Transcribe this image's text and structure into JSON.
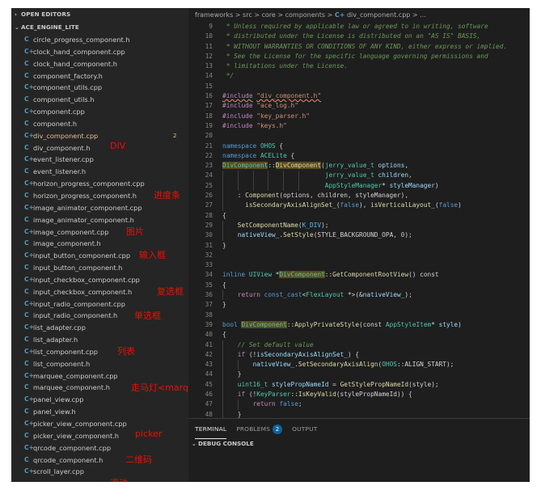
{
  "sidebar": {
    "open_editors_label": "OPEN EDITORS",
    "project_label": "ACE_ENGINE_LITE",
    "files": [
      {
        "icon": "C",
        "name": "circle_progress_component.h"
      },
      {
        "icon": "C+",
        "name": "clock_hand_component.cpp"
      },
      {
        "icon": "C",
        "name": "clock_hand_component.h"
      },
      {
        "icon": "C",
        "name": "component_factory.h"
      },
      {
        "icon": "C+",
        "name": "component_utils.cpp"
      },
      {
        "icon": "C",
        "name": "component_utils.h"
      },
      {
        "icon": "C+",
        "name": "component.cpp"
      },
      {
        "icon": "C",
        "name": "component.h"
      },
      {
        "icon": "C+",
        "name": "div_component.cpp",
        "selected": true,
        "badge": "2"
      },
      {
        "icon": "C",
        "name": "div_component.h"
      },
      {
        "icon": "C+",
        "name": "event_listener.cpp"
      },
      {
        "icon": "C",
        "name": "event_listener.h"
      },
      {
        "icon": "C+",
        "name": "horizon_progress_component.cpp"
      },
      {
        "icon": "C",
        "name": "horizon_progress_component.h"
      },
      {
        "icon": "C+",
        "name": "image_animator_component.cpp"
      },
      {
        "icon": "C",
        "name": "image_animator_component.h"
      },
      {
        "icon": "C+",
        "name": "image_component.cpp"
      },
      {
        "icon": "C",
        "name": "image_component.h"
      },
      {
        "icon": "C+",
        "name": "input_button_component.cpp"
      },
      {
        "icon": "C",
        "name": "input_button_component.h"
      },
      {
        "icon": "C+",
        "name": "input_checkbox_component.cpp"
      },
      {
        "icon": "C",
        "name": "input_checkbox_component.h"
      },
      {
        "icon": "C+",
        "name": "input_radio_component.cpp"
      },
      {
        "icon": "C",
        "name": "input_radio_component.h"
      },
      {
        "icon": "C+",
        "name": "list_adapter.cpp"
      },
      {
        "icon": "C",
        "name": "list_adapter.h"
      },
      {
        "icon": "C+",
        "name": "list_component.cpp"
      },
      {
        "icon": "C",
        "name": "list_component.h"
      },
      {
        "icon": "C+",
        "name": "marquee_component.cpp"
      },
      {
        "icon": "C",
        "name": "marquee_component.h"
      },
      {
        "icon": "C+",
        "name": "panel_view.cpp"
      },
      {
        "icon": "C",
        "name": "panel_view.h"
      },
      {
        "icon": "C+",
        "name": "picker_view_component.cpp"
      },
      {
        "icon": "C",
        "name": "picker_view_component.h"
      },
      {
        "icon": "C+",
        "name": "qrcode_component.cpp"
      },
      {
        "icon": "C",
        "name": "qrcode_component.h"
      },
      {
        "icon": "C+",
        "name": "scroll_layer.cpp"
      }
    ]
  },
  "annotations": [
    {
      "text": "DIV",
      "row": 9
    },
    {
      "text": "进度条",
      "row": 13
    },
    {
      "text": "图片",
      "row": 16
    },
    {
      "text": "输入框",
      "row": 18
    },
    {
      "text": "复选框",
      "row": 21
    },
    {
      "text": "单选框",
      "row": 23
    },
    {
      "text": "列表",
      "row": 26
    },
    {
      "text": "走马灯<marquee>",
      "row": 29
    },
    {
      "text": "picker",
      "row": 33
    },
    {
      "text": "二维码",
      "row": 35
    },
    {
      "text": "滚动",
      "row": 37
    }
  ],
  "breadcrumb": {
    "path": "frameworks > src > core > components > ",
    "file_icon": "C+",
    "file": "div_component.cpp",
    "tail": " > ..."
  },
  "code": [
    {
      "n": "9",
      "t": [
        [
          "cm",
          " * Unless required by applicable law or agreed to in writing, software"
        ]
      ]
    },
    {
      "n": "10",
      "t": [
        [
          "cm",
          " * distributed under the License is distributed on an \"AS IS\" BASIS,"
        ]
      ]
    },
    {
      "n": "11",
      "t": [
        [
          "cm",
          " * WITHOUT WARRANTIES OR CONDITIONS OF ANY KIND, either express or implied."
        ]
      ]
    },
    {
      "n": "12",
      "t": [
        [
          "cm",
          " * See the License for the specific language governing permissions and"
        ]
      ]
    },
    {
      "n": "13",
      "t": [
        [
          "cm",
          " * limitations under the License."
        ]
      ]
    },
    {
      "n": "14",
      "t": [
        [
          "cm",
          " */"
        ]
      ]
    },
    {
      "n": "15",
      "t": []
    },
    {
      "n": "16",
      "t": [
        [
          "kw2 sq",
          "#include"
        ],
        [
          "pl",
          " "
        ],
        [
          "str sq",
          "\"div_component.h\""
        ]
      ]
    },
    {
      "n": "17",
      "t": [
        [
          "kw2",
          "#include"
        ],
        [
          "pl",
          " "
        ],
        [
          "str",
          "\"ace_log.h\""
        ]
      ]
    },
    {
      "n": "18",
      "t": [
        [
          "kw2",
          "#include"
        ],
        [
          "pl",
          " "
        ],
        [
          "str",
          "\"key_parser.h\""
        ]
      ]
    },
    {
      "n": "19",
      "t": [
        [
          "kw2",
          "#include"
        ],
        [
          "pl",
          " "
        ],
        [
          "str",
          "\"keys.h\""
        ]
      ]
    },
    {
      "n": "20",
      "t": []
    },
    {
      "n": "21",
      "t": [
        [
          "kw",
          "namespace"
        ],
        [
          "pl",
          " "
        ],
        [
          "ty",
          "OHOS"
        ],
        [
          "pl",
          " {"
        ]
      ]
    },
    {
      "n": "22",
      "t": [
        [
          "kw",
          "namespace"
        ],
        [
          "pl",
          " "
        ],
        [
          "ty",
          "ACELite"
        ],
        [
          "pl",
          " {"
        ]
      ]
    },
    {
      "n": "23",
      "t": [
        [
          "ty hl",
          "DivComponent"
        ],
        [
          "pl",
          "::"
        ],
        [
          "fn hl",
          "DivComponent"
        ],
        [
          "pl",
          "("
        ],
        [
          "ty",
          "jerry_value_t"
        ],
        [
          "pl",
          " "
        ],
        [
          "var",
          "options"
        ],
        [
          "pl",
          ","
        ]
      ]
    },
    {
      "n": "24",
      "t": [
        [
          "pl",
          "                           "
        ],
        [
          "ty",
          "jerry_value_t"
        ],
        [
          "pl",
          " "
        ],
        [
          "var",
          "children"
        ],
        [
          "pl",
          ","
        ]
      ]
    },
    {
      "n": "25",
      "t": [
        [
          "pl",
          "                           "
        ],
        [
          "ty",
          "AppStyleManager"
        ],
        [
          "pl",
          "* "
        ],
        [
          "var",
          "styleManager"
        ],
        [
          "pl",
          ")"
        ]
      ]
    },
    {
      "n": "26",
      "t": [
        [
          "pl",
          "    : "
        ],
        [
          "fn",
          "Component"
        ],
        [
          "pl",
          "(options, children, styleManager),"
        ]
      ]
    },
    {
      "n": "27",
      "t": [
        [
          "pl",
          "      "
        ],
        [
          "fn",
          "isSecondaryAxisAlignSet_"
        ],
        [
          "pl",
          "("
        ],
        [
          "kw",
          "false"
        ],
        [
          "pl",
          "), "
        ],
        [
          "fn",
          "isVerticalLayout_"
        ],
        [
          "pl",
          "("
        ],
        [
          "kw",
          "false"
        ],
        [
          "pl",
          ")"
        ]
      ]
    },
    {
      "n": "28",
      "t": [
        [
          "pl",
          "{"
        ]
      ]
    },
    {
      "n": "29",
      "t": [
        [
          "pl",
          "    "
        ],
        [
          "fn",
          "SetComponentName"
        ],
        [
          "pl",
          "("
        ],
        [
          "cst",
          "K_DIV"
        ],
        [
          "pl",
          ");"
        ]
      ]
    },
    {
      "n": "30",
      "t": [
        [
          "pl",
          "    "
        ],
        [
          "var",
          "nativeView_"
        ],
        [
          "pl",
          "."
        ],
        [
          "fn",
          "SetStyle"
        ],
        [
          "pl",
          "(STYLE_BACKGROUND_OPA, "
        ],
        [
          "num",
          "0"
        ],
        [
          "pl",
          ");"
        ]
      ]
    },
    {
      "n": "31",
      "t": [
        [
          "pl",
          "}"
        ]
      ]
    },
    {
      "n": "32",
      "t": []
    },
    {
      "n": "33",
      "t": []
    },
    {
      "n": "34",
      "t": [
        [
          "kw",
          "inline"
        ],
        [
          "pl",
          " "
        ],
        [
          "ty",
          "UIView"
        ],
        [
          "pl",
          " *"
        ],
        [
          "ty hl",
          "DivComponent"
        ],
        [
          "pl",
          "::"
        ],
        [
          "fn",
          "GetComponentRootView"
        ],
        [
          "pl",
          "() const"
        ]
      ]
    },
    {
      "n": "35",
      "t": [
        [
          "pl",
          "{"
        ]
      ]
    },
    {
      "n": "36",
      "t": [
        [
          "pl",
          "    "
        ],
        [
          "kw2",
          "return"
        ],
        [
          "pl",
          " "
        ],
        [
          "kw",
          "const_cast"
        ],
        [
          "pl",
          "<"
        ],
        [
          "ty",
          "FlexLayout"
        ],
        [
          "pl",
          " *>(&"
        ],
        [
          "var",
          "nativeView_"
        ],
        [
          "pl",
          ");"
        ]
      ]
    },
    {
      "n": "37",
      "t": [
        [
          "pl",
          "}"
        ]
      ]
    },
    {
      "n": "38",
      "t": []
    },
    {
      "n": "39",
      "t": [
        [
          "kw",
          "bool"
        ],
        [
          "pl",
          " "
        ],
        [
          "ty hl",
          "DivComponent"
        ],
        [
          "pl",
          "::"
        ],
        [
          "fn",
          "ApplyPrivateStyle"
        ],
        [
          "pl",
          "(const "
        ],
        [
          "ty",
          "AppStyleItem"
        ],
        [
          "pl",
          "* "
        ],
        [
          "var",
          "style"
        ],
        [
          "pl",
          ")"
        ]
      ]
    },
    {
      "n": "40",
      "t": [
        [
          "pl",
          "{"
        ]
      ]
    },
    {
      "n": "41",
      "t": [
        [
          "pl",
          "    "
        ],
        [
          "cm",
          "// Set default value"
        ]
      ]
    },
    {
      "n": "42",
      "t": [
        [
          "pl",
          "    "
        ],
        [
          "kw2",
          "if"
        ],
        [
          "pl",
          " (!"
        ],
        [
          "var",
          "isSecondaryAxisAlignSet_"
        ],
        [
          "pl",
          ") {"
        ]
      ]
    },
    {
      "n": "43",
      "t": [
        [
          "pl",
          "        "
        ],
        [
          "var",
          "nativeView_"
        ],
        [
          "pl",
          "."
        ],
        [
          "fn",
          "SetSecondaryAxisAlign"
        ],
        [
          "pl",
          "("
        ],
        [
          "ty",
          "OHOS"
        ],
        [
          "pl",
          "::ALIGN_START);"
        ]
      ]
    },
    {
      "n": "44",
      "t": [
        [
          "pl",
          "    }"
        ]
      ]
    },
    {
      "n": "45",
      "t": [
        [
          "pl",
          "    "
        ],
        [
          "ty",
          "uint16_t"
        ],
        [
          "pl",
          " "
        ],
        [
          "var",
          "stylePropNameId"
        ],
        [
          "pl",
          " = "
        ],
        [
          "fn",
          "GetStylePropNameId"
        ],
        [
          "pl",
          "(style);"
        ]
      ]
    },
    {
      "n": "46",
      "t": [
        [
          "pl",
          "    "
        ],
        [
          "kw2",
          "if"
        ],
        [
          "pl",
          " (!"
        ],
        [
          "ty",
          "KeyParser"
        ],
        [
          "pl",
          "::"
        ],
        [
          "fn",
          "IsKeyValid"
        ],
        [
          "pl",
          "(stylePropNameId)) {"
        ]
      ]
    },
    {
      "n": "47",
      "t": [
        [
          "pl",
          "        "
        ],
        [
          "kw2",
          "return"
        ],
        [
          "pl",
          " "
        ],
        [
          "kw",
          "false"
        ],
        [
          "pl",
          ";"
        ]
      ]
    },
    {
      "n": "48",
      "t": [
        [
          "pl",
          "    }"
        ]
      ]
    }
  ],
  "panel": {
    "tabs": [
      {
        "label": "TERMINAL",
        "active": true
      },
      {
        "label": "PROBLEMS",
        "count": "2"
      },
      {
        "label": "OUTPUT"
      }
    ],
    "debug_label": "DEBUG CONSOLE"
  },
  "colors": {
    "annotation": "#e51400",
    "selected_file": "#e2c08d",
    "cpp_icon": "#519aba"
  }
}
